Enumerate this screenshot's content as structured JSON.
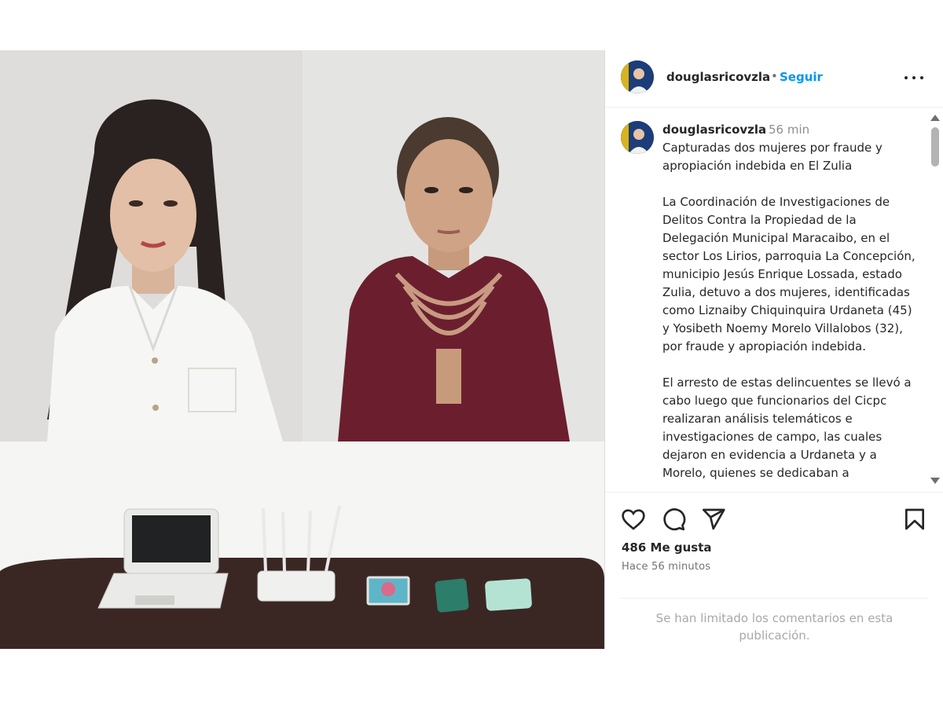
{
  "post": {
    "username": "douglasricovzla",
    "follow_label": "Seguir",
    "separator": "•",
    "more_options_icon": "more-options-icon",
    "caption": {
      "username": "douglasricovzla",
      "time": "56 min",
      "text": "Capturadas dos mujeres por fraude y apropiación indebida en El Zulia\n\nLa Coordinación de Investigaciones de Delitos Contra la Propiedad de la Delegación Municipal Maracaibo, en el sector Los Lirios, parroquia La Concepción, municipio Jesús Enrique Lossada, estado Zulia, detuvo a dos mujeres, identificadas como Liznaiby Chiquinquira Urdaneta (45) y Yosibeth Noemy Morelo Villalobos (32), por fraude y apropiación indebida.\n\nEl arresto de estas delincuentes se llevó a cabo luego que funcionarios del Cicpc realizaran análisis telemáticos e investigaciones de campo, las cuales dejaron en evidencia a Urdaneta y a Morelo, quienes se dedicaban a"
    },
    "likes": "486 Me gusta",
    "posted_ago": "Hace 56 minutos",
    "comments_limited": "Se han limitado los comentarios en esta publicación.",
    "icons": [
      "heart-icon",
      "comment-icon",
      "share-icon",
      "bookmark-icon"
    ],
    "colors": {
      "link": "#0095f6",
      "text": "#262626",
      "muted": "#737373",
      "shirt": "#6b1f2e"
    }
  }
}
